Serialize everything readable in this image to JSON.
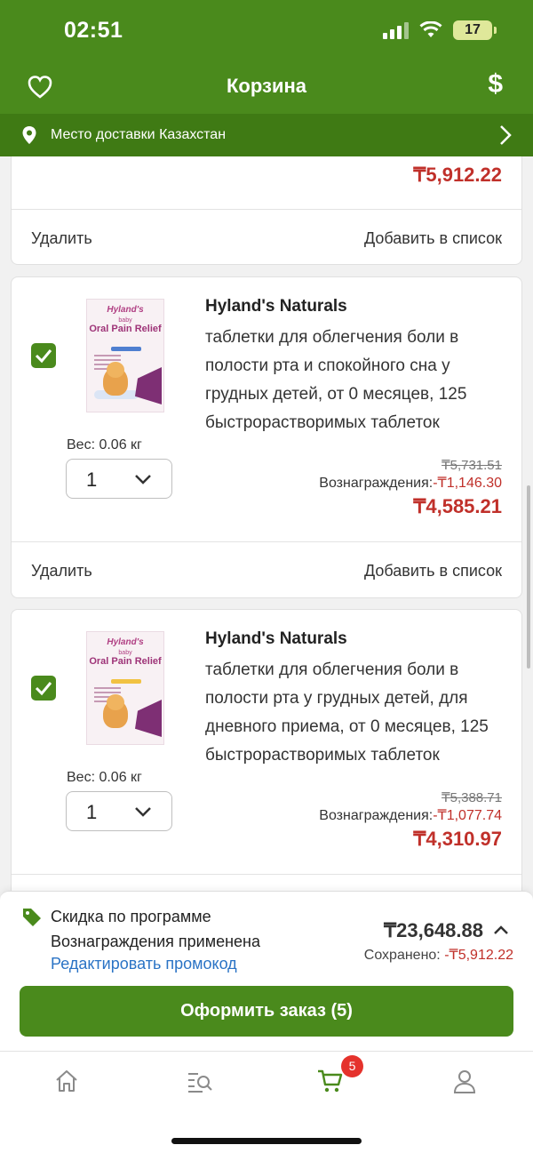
{
  "status_bar": {
    "time": "02:51",
    "battery": "17"
  },
  "header": {
    "title": "Корзина",
    "currency_symbol": "$"
  },
  "delivery": {
    "label": "Место доставки Казахстан"
  },
  "cart_items": [
    {
      "price_final": "₸5,912.22",
      "remove_label": "Удалить",
      "add_to_list_label": "Добавить в список"
    },
    {
      "checked": true,
      "image_brand": "Hyland's",
      "image_baby": "baby",
      "image_title": "Oral Pain Relief",
      "brand": "Hyland's Naturals",
      "description": "таблетки для облегчения боли в полости рта и спокойного сна у грудных детей, от 0 месяцев, 125 быстрорастворимых таблеток",
      "weight": "Вес: 0.06 кг",
      "quantity": "1",
      "price_old": "₸5,731.51",
      "rewards_label": "Вознаграждения:",
      "rewards_value": "-₸1,146.30",
      "price_final": "₸4,585.21",
      "remove_label": "Удалить",
      "add_to_list_label": "Добавить в список"
    },
    {
      "checked": true,
      "image_brand": "Hyland's",
      "image_baby": "baby",
      "image_title": "Oral Pain Relief",
      "brand": "Hyland's Naturals",
      "description": "таблетки для облегчения боли в полости рта у грудных детей, для дневного приема, от 0 месяцев, 125 быстрорастворимых таблеток",
      "weight": "Вес: 0.06 кг",
      "quantity": "1",
      "price_old": "₸5,388.71",
      "rewards_label": "Вознаграждения:",
      "rewards_value": "-₸1,077.74",
      "price_final": "₸4,310.97"
    }
  ],
  "summary": {
    "discount_text": "Скидка по программе Вознаграждения применена",
    "promo_link": "Редактировать промокод",
    "total": "₸23,648.88",
    "saved_label": "Сохранено:",
    "saved_value": "-₸5,912.22",
    "checkout_label": "Оформить заказ (5)"
  },
  "tabbar": {
    "cart_badge": "5"
  },
  "colors": {
    "brand_green": "#4a8a1c",
    "price_red": "#c0302a",
    "link_blue": "#2a73c5",
    "badge_red": "#e5322c"
  },
  "icons": [
    "heart-icon",
    "dollar-icon",
    "location-pin-icon",
    "chevron-right-icon",
    "checkmark-icon",
    "chevron-down-icon",
    "tag-icon",
    "chevron-up-icon",
    "home-icon",
    "catalog-search-icon",
    "cart-icon",
    "account-icon"
  ]
}
